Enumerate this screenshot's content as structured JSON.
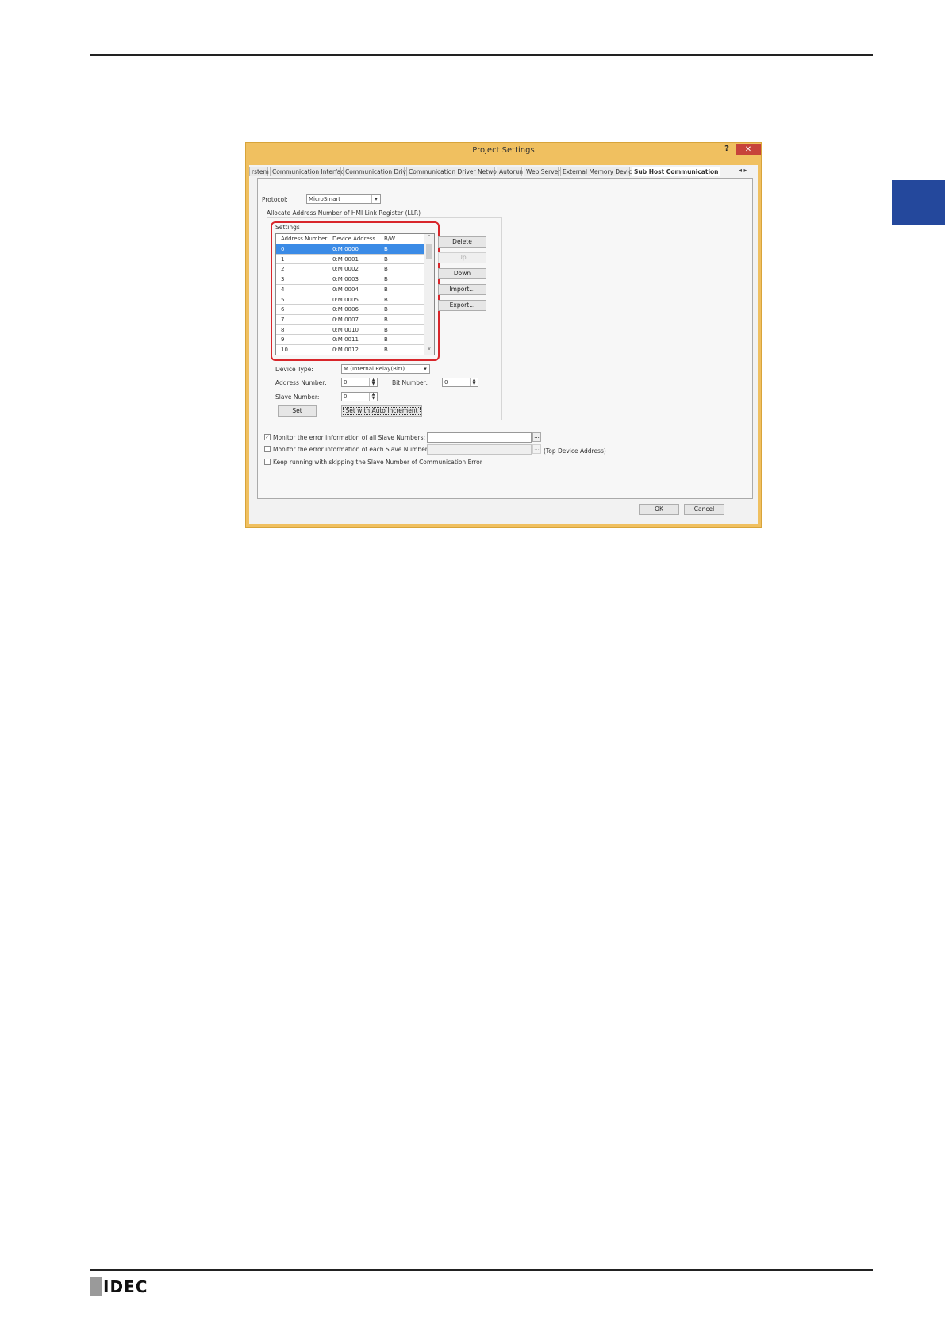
{
  "brand": {
    "logo_text": "IDEC"
  },
  "dialog": {
    "title": "Project Settings",
    "help_label": "?",
    "close_label": "✕",
    "tabs": [
      "rstem",
      "Communication Interface",
      "Communication Driver",
      "Communication Driver Network",
      "Autorun",
      "Web Server",
      "External Memory Device",
      "Sub Host Communication"
    ],
    "active_tab": "Sub Host Communication",
    "tab_nav": "◂ ▸",
    "protocol": {
      "label": "Protocol:",
      "value": "MicroSmart"
    },
    "allocate_label": "Allocate Address Number of HMI Link Register (LLR)",
    "settings_label": "Settings",
    "list": {
      "headers": [
        "Address Number",
        "Device Address",
        "B/W"
      ],
      "rows": [
        [
          "0",
          "0:M 0000",
          "B"
        ],
        [
          "1",
          "0:M 0001",
          "B"
        ],
        [
          "2",
          "0:M 0002",
          "B"
        ],
        [
          "3",
          "0:M 0003",
          "B"
        ],
        [
          "4",
          "0:M 0004",
          "B"
        ],
        [
          "5",
          "0:M 0005",
          "B"
        ],
        [
          "6",
          "0:M 0006",
          "B"
        ],
        [
          "7",
          "0:M 0007",
          "B"
        ],
        [
          "8",
          "0:M 0010",
          "B"
        ],
        [
          "9",
          "0:M 0011",
          "B"
        ],
        [
          "10",
          "0:M 0012",
          "B"
        ]
      ],
      "scroll_up": "^",
      "scroll_down": "v"
    },
    "buttons": {
      "delete": "Delete",
      "up": "Up",
      "down": "Down",
      "import": "Import...",
      "export": "Export...",
      "set": "Set",
      "set_auto": "Set with Auto Increment",
      "ok": "OK",
      "cancel": "Cancel",
      "browse": "..."
    },
    "device_type": {
      "label": "Device Type:",
      "value": "M (Internal Relay(Bit))"
    },
    "address_number": {
      "label": "Address Number:",
      "value": "0"
    },
    "bit_number": {
      "label": "Bit Number:",
      "value": "0"
    },
    "slave_number": {
      "label": "Slave Number:",
      "value": "0"
    },
    "options": {
      "monitor_all": "Monitor the error information of all Slave Numbers:",
      "monitor_each": "Monitor the error information of each Slave Number:",
      "top_device_address": "(Top Device Address)",
      "keep_running": "Keep running with skipping the Slave Number of Communication Error"
    }
  }
}
